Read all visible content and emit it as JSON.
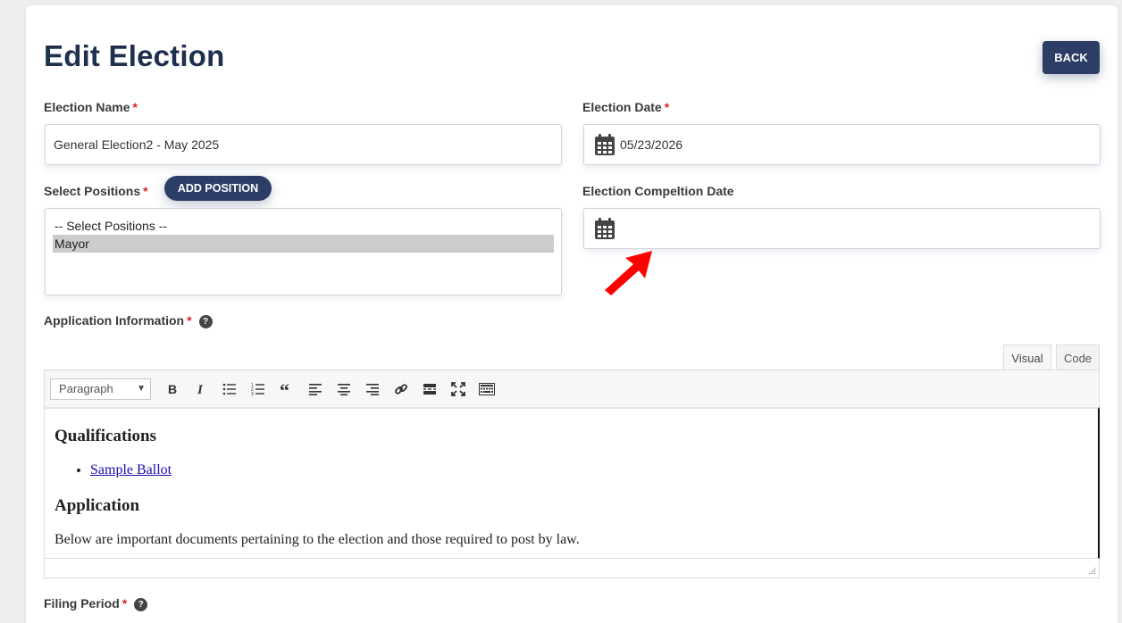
{
  "header": {
    "title": "Edit Election",
    "back_label": "BACK"
  },
  "fields": {
    "election_name": {
      "label": "Election Name",
      "required": "*",
      "value": "General Election2 - May 2025"
    },
    "election_date": {
      "label": "Election Date",
      "required": "*",
      "value": "05/23/2026",
      "icon": "calendar-icon"
    },
    "select_positions": {
      "label": "Select Positions",
      "required": "*",
      "add_label": "ADD POSITION",
      "options": [
        "-- Select Positions --",
        "Mayor"
      ]
    },
    "completion_date": {
      "label": "Election Compeltion Date",
      "value": "",
      "icon": "calendar-icon"
    },
    "application_info": {
      "label": "Application Information",
      "required": "*",
      "help": "?"
    },
    "filing_period": {
      "label": "Filing Period",
      "required": "*",
      "help": "?"
    }
  },
  "editor": {
    "tabs": [
      "Visual",
      "Code"
    ],
    "format_select": "Paragraph",
    "toolbar_icons": [
      "bold-icon",
      "italic-icon",
      "bullet-list-icon",
      "numbered-list-icon",
      "blockquote-icon",
      "align-left-icon",
      "align-center-icon",
      "align-right-icon",
      "link-icon",
      "read-more-icon",
      "fullscreen-icon",
      "toolbar-toggle-icon"
    ],
    "content": {
      "heading1": "Qualifications",
      "link": "Sample Ballot",
      "heading2": "Application",
      "paragraph": "Below are important documents pertaining to the election and those required to post by law."
    }
  },
  "colors": {
    "primary": "#2c3e66",
    "title": "#1f2f4f",
    "required": "#e0202a",
    "annotation_arrow": "#ff0000"
  }
}
